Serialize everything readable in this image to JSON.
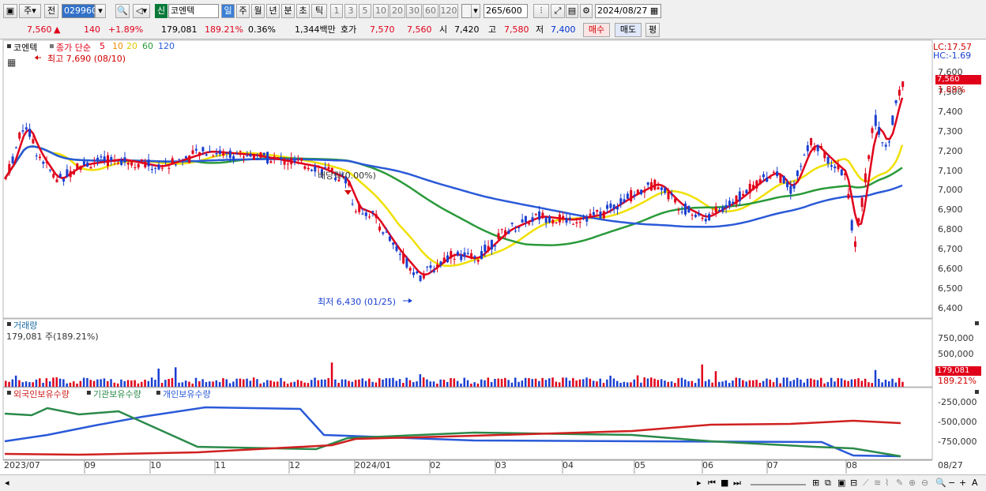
{
  "toolbar": {
    "period_week": "주",
    "prev_label": "전",
    "code": "029960",
    "market_badge": "신",
    "stock_name": "코엔텍",
    "timeframes": [
      "일",
      "주",
      "월",
      "년",
      "분",
      "초",
      "틱"
    ],
    "intervals": [
      "1",
      "3",
      "5",
      "10",
      "20",
      "30",
      "60",
      "120"
    ],
    "count": "265",
    "count_total": "/600",
    "date": "2024/08/27"
  },
  "quote": {
    "price": "7,560",
    "arrow": "▲",
    "change": "140",
    "change_pct": "+1.89%",
    "volume": "179,081",
    "volume_ratio": "189.21%",
    "turnover": "0.36%",
    "amount": "1,344백만",
    "hoga_label": "호가",
    "hoga_ask": "7,570",
    "hoga_bid": "7,560",
    "open_label": "시",
    "open": "7,420",
    "high_label": "고",
    "high": "7,580",
    "low_label": "저",
    "low": "7,400",
    "buy_button": "매수",
    "sell_button": "매도",
    "eval_button": "평"
  },
  "price_panel": {
    "name": "코엔텍",
    "ma_label": "종가 단순",
    "ma_periods": [
      "5",
      "10",
      "20",
      "60",
      "120"
    ],
    "high_note": "최고 7,690 (08/10)",
    "low_note": "최저 6,430 (01/25)",
    "dividend_note": "배당락(0.00%)",
    "lc": "LC:17.57",
    "hc": "HC:-1.69",
    "last_price": "7,560",
    "last_pct": "1.89%",
    "y_labels": [
      "7,600",
      "7,500",
      "7,400",
      "7,300",
      "7,200",
      "7,100",
      "7,000",
      "6,900",
      "6,800",
      "6,700",
      "6,600",
      "6,500",
      "6,400"
    ]
  },
  "volume_panel": {
    "title": "거래량",
    "value_note": "179,081 주(189.21%)",
    "y_labels": [
      "750,000",
      "500,000",
      "250,000"
    ],
    "last_value": "179,081",
    "last_pct": "189.21%"
  },
  "holding_panel": {
    "legend": [
      "외국인보유수량",
      "기관보유수량",
      "개인보유수량"
    ],
    "y_labels": [
      "-250,000",
      "-500,000",
      "-750,000"
    ]
  },
  "x_axis": {
    "labels": [
      "2023/07",
      "09",
      "10",
      "11",
      "12",
      "2024/01",
      "02",
      "03",
      "04",
      "05",
      "06",
      "07",
      "08",
      "08/27"
    ]
  },
  "colors": {
    "up": "#e0001a",
    "down": "#1a3fd0",
    "ma5": "#e0001a",
    "ma10": "#f08c00",
    "ma20": "#f0e000",
    "ma60": "#2a9a3a",
    "ma120": "#2a5ad8",
    "foreign": "#d02020",
    "institution": "#2a8a4a",
    "individual": "#2a5ad8"
  }
}
